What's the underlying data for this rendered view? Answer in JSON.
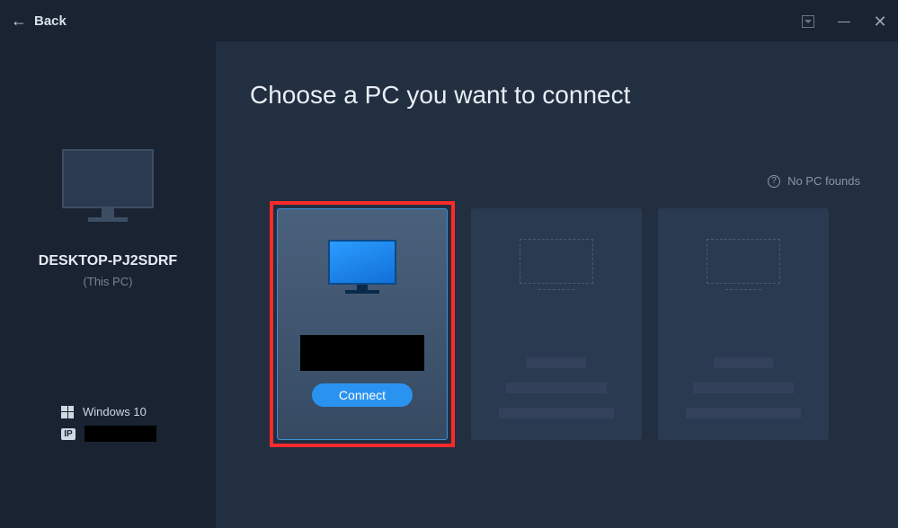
{
  "titlebar": {
    "back_label": "Back"
  },
  "sidebar": {
    "pc_name": "DESKTOP-PJ2SDRF",
    "pc_note": "(This PC)",
    "os_label": "Windows 10",
    "ip_badge": "IP"
  },
  "content": {
    "title": "Choose a PC you want to connect",
    "help_text": "No PC founds",
    "connect_label": "Connect"
  }
}
